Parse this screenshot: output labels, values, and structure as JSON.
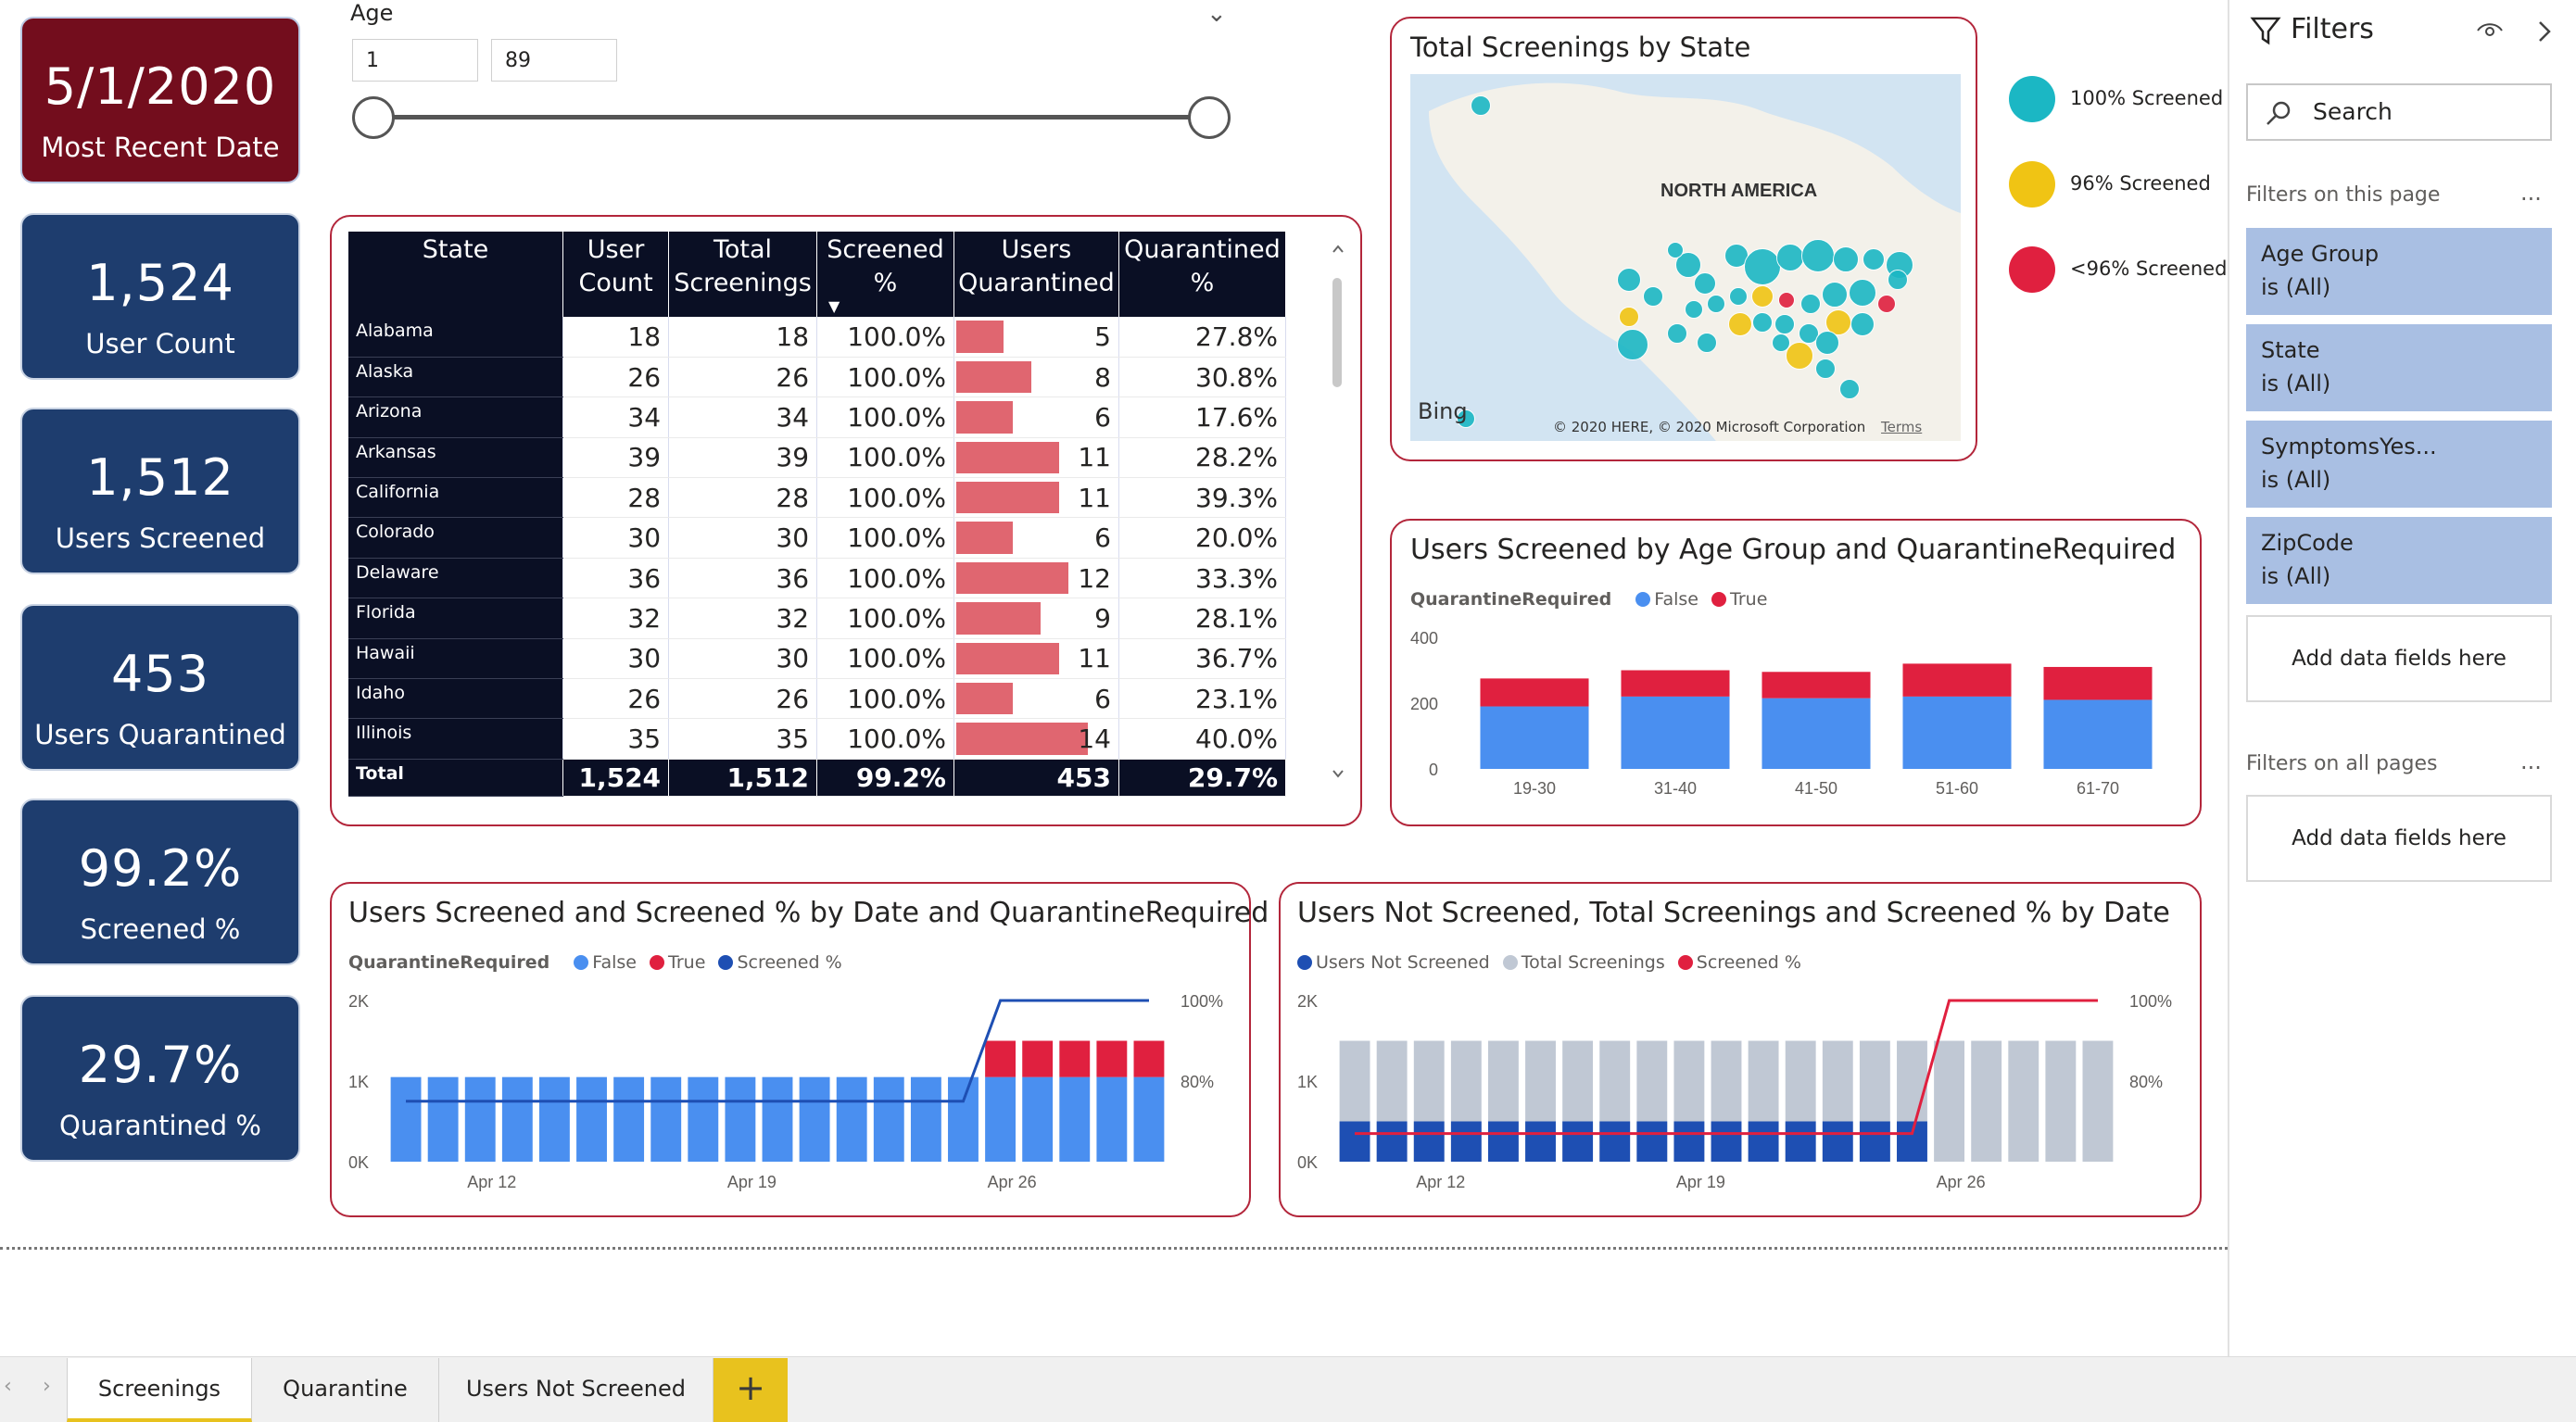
{
  "kpis": {
    "recent_date": {
      "value": "5/1/2020",
      "label": "Most Recent Date"
    },
    "user_count": {
      "value": "1,524",
      "label": "User Count"
    },
    "users_screened": {
      "value": "1,512",
      "label": "Users Screened"
    },
    "users_quarantined": {
      "value": "453",
      "label": "Users Quarantined"
    },
    "screened_pct": {
      "value": "99.2%",
      "label": "Screened %"
    },
    "quarantined_pct": {
      "value": "29.7%",
      "label": "Quarantined %"
    }
  },
  "age_slicer": {
    "title": "Age",
    "min": "1",
    "max": "89",
    "range_min": 1,
    "range_max": 89
  },
  "table": {
    "headers": [
      "State",
      "User\nCount",
      "Total\nScreenings",
      "Screened\n%",
      "Users\nQuarantined",
      "Quarantined\n%"
    ],
    "sort_indicator": "▼",
    "rows": [
      {
        "state": "Alabama",
        "user_count": "18",
        "total_screenings": "18",
        "screened_pct": "100.0%",
        "users_quarantined": "5",
        "quarantined_pct": "27.8%"
      },
      {
        "state": "Alaska",
        "user_count": "26",
        "total_screenings": "26",
        "screened_pct": "100.0%",
        "users_quarantined": "8",
        "quarantined_pct": "30.8%"
      },
      {
        "state": "Arizona",
        "user_count": "34",
        "total_screenings": "34",
        "screened_pct": "100.0%",
        "users_quarantined": "6",
        "quarantined_pct": "17.6%"
      },
      {
        "state": "Arkansas",
        "user_count": "39",
        "total_screenings": "39",
        "screened_pct": "100.0%",
        "users_quarantined": "11",
        "quarantined_pct": "28.2%"
      },
      {
        "state": "California",
        "user_count": "28",
        "total_screenings": "28",
        "screened_pct": "100.0%",
        "users_quarantined": "11",
        "quarantined_pct": "39.3%"
      },
      {
        "state": "Colorado",
        "user_count": "30",
        "total_screenings": "30",
        "screened_pct": "100.0%",
        "users_quarantined": "6",
        "quarantined_pct": "20.0%"
      },
      {
        "state": "Delaware",
        "user_count": "36",
        "total_screenings": "36",
        "screened_pct": "100.0%",
        "users_quarantined": "12",
        "quarantined_pct": "33.3%"
      },
      {
        "state": "Florida",
        "user_count": "32",
        "total_screenings": "32",
        "screened_pct": "100.0%",
        "users_quarantined": "9",
        "quarantined_pct": "28.1%"
      },
      {
        "state": "Hawaii",
        "user_count": "30",
        "total_screenings": "30",
        "screened_pct": "100.0%",
        "users_quarantined": "11",
        "quarantined_pct": "36.7%"
      },
      {
        "state": "Idaho",
        "user_count": "26",
        "total_screenings": "26",
        "screened_pct": "100.0%",
        "users_quarantined": "6",
        "quarantined_pct": "23.1%"
      },
      {
        "state": "Illinois",
        "user_count": "35",
        "total_screenings": "35",
        "screened_pct": "100.0%",
        "users_quarantined": "14",
        "quarantined_pct": "40.0%"
      }
    ],
    "total": {
      "state": "Total",
      "user_count": "1,524",
      "total_screenings": "1,512",
      "screened_pct": "99.2%",
      "users_quarantined": "453",
      "quarantined_pct": "29.7%"
    },
    "quarantined_bar_max": 14
  },
  "map": {
    "title": "Total Screenings by State",
    "region_label": "NORTH AMERICA",
    "logo_text": "Bing",
    "copyright": "© 2020 HERE, © 2020 Microsoft Corporation",
    "terms": "Terms",
    "legend": [
      {
        "label": "100% Screened",
        "color": "#1bb7c4"
      },
      {
        "label": "96% Screened",
        "color": "#f0c414"
      },
      {
        "label": "<96% Screened",
        "color": "#e0203f"
      }
    ]
  },
  "chart_data": [
    {
      "type": "bar",
      "stacked": true,
      "title": "Users Screened by Age Group and QuarantineRequired",
      "legend_title": "QuarantineRequired",
      "categories": [
        "19-30",
        "31-40",
        "41-50",
        "51-60",
        "61-70"
      ],
      "series": [
        {
          "name": "False",
          "color": "#4a8ff0",
          "values": [
            190,
            220,
            215,
            220,
            210
          ]
        },
        {
          "name": "True",
          "color": "#e0203f",
          "values": [
            85,
            80,
            80,
            100,
            100
          ]
        }
      ],
      "ylim": [
        0,
        400
      ],
      "yticks": [
        "0",
        "200",
        "400"
      ]
    },
    {
      "type": "bar",
      "stacked": true,
      "title": "Users Screened and Screened % by Date and QuarantineRequired",
      "legend_title": "QuarantineRequired",
      "categories": [
        "Apr 10",
        "Apr 11",
        "Apr 12",
        "Apr 13",
        "Apr 14",
        "Apr 15",
        "Apr 16",
        "Apr 17",
        "Apr 18",
        "Apr 19",
        "Apr 20",
        "Apr 21",
        "Apr 22",
        "Apr 23",
        "Apr 24",
        "Apr 25",
        "Apr 26",
        "Apr 27",
        "Apr 28",
        "Apr 29",
        "Apr 30"
      ],
      "xtick_labels": [
        "Apr 12",
        "Apr 19",
        "Apr 26"
      ],
      "series": [
        {
          "name": "False",
          "color": "#4a8ff0",
          "values": [
            1050,
            1050,
            1050,
            1050,
            1050,
            1050,
            1050,
            1050,
            1050,
            1050,
            1050,
            1050,
            1050,
            1050,
            1050,
            1050,
            1050,
            1050,
            1050,
            1050,
            1050
          ]
        },
        {
          "name": "True",
          "color": "#e0203f",
          "values": [
            0,
            0,
            0,
            0,
            0,
            0,
            0,
            0,
            0,
            0,
            0,
            0,
            0,
            0,
            0,
            0,
            450,
            450,
            450,
            450,
            450
          ]
        }
      ],
      "line": {
        "name": "Screened %",
        "color": "#1e4fb3",
        "values": [
          75,
          75,
          75,
          75,
          75,
          75,
          75,
          75,
          75,
          75,
          75,
          75,
          75,
          75,
          75,
          75,
          100,
          100,
          100,
          100,
          100
        ]
      },
      "ylim": [
        0,
        2000
      ],
      "yticks": [
        "0K",
        "1K",
        "2K"
      ],
      "y2ticks": [
        "80%",
        "100%"
      ],
      "y2lim": [
        60,
        100
      ]
    },
    {
      "type": "bar",
      "title": "Users Not Screened, Total Screenings and Screened % by Date",
      "categories": [
        "Apr 10",
        "Apr 11",
        "Apr 12",
        "Apr 13",
        "Apr 14",
        "Apr 15",
        "Apr 16",
        "Apr 17",
        "Apr 18",
        "Apr 19",
        "Apr 20",
        "Apr 21",
        "Apr 22",
        "Apr 23",
        "Apr 24",
        "Apr 25",
        "Apr 26",
        "Apr 27",
        "Apr 28",
        "Apr 29",
        "Apr 30"
      ],
      "xtick_labels": [
        "Apr 12",
        "Apr 19",
        "Apr 26"
      ],
      "series": [
        {
          "name": "Users Not Screened",
          "color": "#1e4fb3",
          "values": [
            500,
            500,
            500,
            500,
            500,
            500,
            500,
            500,
            500,
            500,
            500,
            500,
            500,
            500,
            500,
            500,
            0,
            0,
            0,
            0,
            0
          ]
        },
        {
          "name": "Total Screenings",
          "color": "#c0c8d4",
          "values": [
            1500,
            1500,
            1500,
            1500,
            1500,
            1500,
            1500,
            1500,
            1500,
            1500,
            1500,
            1500,
            1500,
            1500,
            1500,
            1500,
            1500,
            1500,
            1500,
            1500,
            1500
          ]
        }
      ],
      "line": {
        "name": "Screened %",
        "color": "#e0203f",
        "values": [
          67,
          67,
          67,
          67,
          67,
          67,
          67,
          67,
          67,
          67,
          67,
          67,
          67,
          67,
          67,
          67,
          100,
          100,
          100,
          100,
          100
        ]
      },
      "ylim": [
        0,
        2000
      ],
      "yticks": [
        "0K",
        "1K",
        "2K"
      ],
      "y2ticks": [
        "80%",
        "100%"
      ],
      "y2lim": [
        60,
        100
      ]
    }
  ],
  "filters": {
    "title": "Filters",
    "search_placeholder": "Search",
    "page_section": "Filters on this page",
    "all_section": "Filters on all pages",
    "more": "...",
    "add_label": "Add data fields here",
    "cards": [
      {
        "name": "Age Group",
        "value": "is (All)"
      },
      {
        "name": "State",
        "value": "is (All)"
      },
      {
        "name": "SymptomsYes...",
        "value": "is (All)"
      },
      {
        "name": "ZipCode",
        "value": "is (All)"
      }
    ]
  },
  "tabs": [
    {
      "label": "Screenings",
      "active": true
    },
    {
      "label": "Quarantine",
      "active": false
    },
    {
      "label": "Users Not Screened",
      "active": false
    }
  ],
  "add_tab": "+"
}
